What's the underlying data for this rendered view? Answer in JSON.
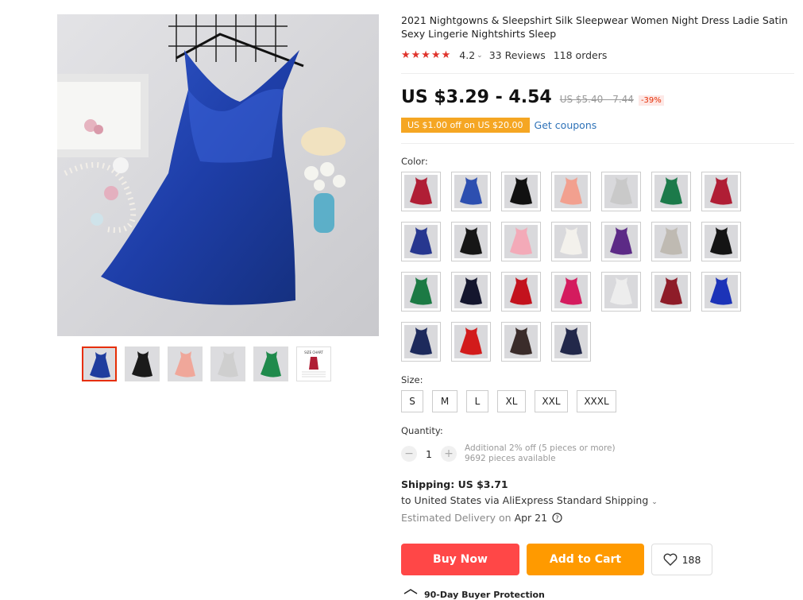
{
  "product": {
    "title": "2021 Nightgowns & Sleepshirt Silk Sleepwear Women Night Dress Ladie Satin Sexy Lingerie Nightshirts Sleep",
    "rating": "4.2",
    "reviews": "33 Reviews",
    "orders": "118 orders",
    "price": "US $3.29 - 4.54",
    "original_price": "US $5.40 - 7.44",
    "discount": "-39%",
    "coupon_badge": "US $1.00 off on US $20.00",
    "coupon_link": "Get coupons"
  },
  "gallery": {
    "thumbnails": [
      {
        "color": "#1f3d9e"
      },
      {
        "color": "#1a1a1a"
      },
      {
        "color": "#f0a79a"
      },
      {
        "color": "#cfcfcf"
      },
      {
        "color": "#1f8a4c"
      },
      {
        "color": "#ffffff",
        "label": "SIZE CHART"
      }
    ]
  },
  "color_section": {
    "label": "Color:",
    "swatches": [
      "#b01e35",
      "#2d4fb0",
      "#111111",
      "#f2a08f",
      "#c9c9c9",
      "#1c7a4a",
      "#b01e35",
      "#27378f",
      "#161616",
      "#f3aab8",
      "#f3f1ec",
      "#5c2a86",
      "#bfbab2",
      "#141414",
      "#1c7a44",
      "#14162e",
      "#c3121d",
      "#d41b5e",
      "#ededed",
      "#8e1c28",
      "#1c33b8",
      "#1d2a5c",
      "#d21b1b",
      "#3a2c2a",
      "#22284a"
    ]
  },
  "size_section": {
    "label": "Size:",
    "sizes": [
      "S",
      "M",
      "L",
      "XL",
      "XXL",
      "XXXL"
    ]
  },
  "quantity": {
    "label": "Quantity:",
    "minus": "−",
    "value": "1",
    "plus": "+",
    "note": "Additional 2% off (5 pieces or more)",
    "available": "9692 pieces available"
  },
  "shipping": {
    "title": "Shipping: US $3.71",
    "route": "to United States via AliExpress Standard Shipping",
    "caret": "⌄",
    "delivery_prefix": "Estimated Delivery on",
    "delivery_date": "Apr 21"
  },
  "actions": {
    "buy_now": "Buy Now",
    "add_to_cart": "Add to Cart",
    "wishlist_count": "188"
  },
  "protection": "90-Day Buyer Protection",
  "colors": {
    "buy": "#ff4747",
    "cart": "#ff9a00",
    "star": "#e0332b",
    "link": "#2e72b8"
  }
}
